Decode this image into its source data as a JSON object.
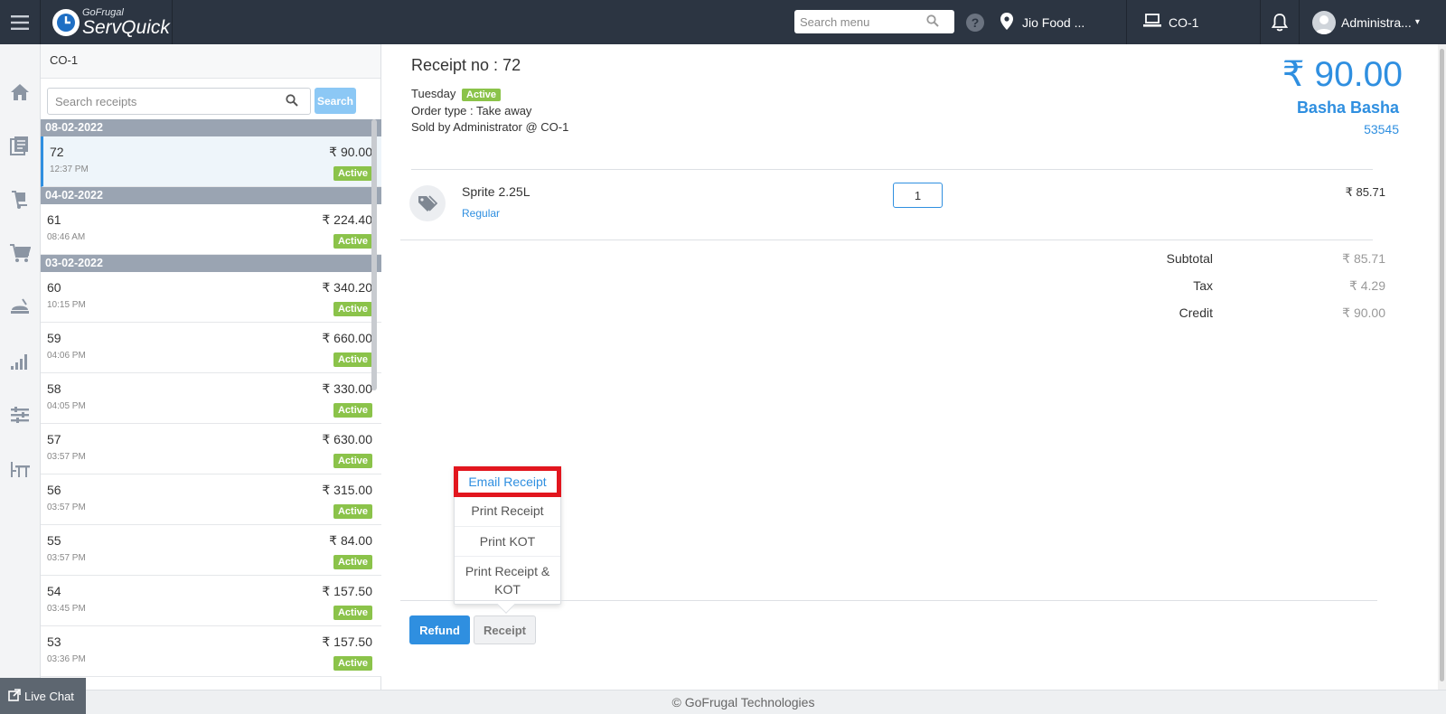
{
  "header": {
    "logo_small": "GoFrugal",
    "logo_big": "ServQuick",
    "search_placeholder": "Search menu",
    "location": "Jio Food ...",
    "counter": "CO-1",
    "user": "Administra..."
  },
  "sidebar": {
    "counter_label": "CO-1",
    "search_placeholder": "Search receipts",
    "search_button": "Search",
    "groups": [
      {
        "date": "08-02-2022",
        "rows": [
          {
            "num": "72",
            "time": "12:37 PM",
            "amount": "₹ 90.00",
            "status": "Active"
          }
        ]
      },
      {
        "date": "04-02-2022",
        "rows": [
          {
            "num": "61",
            "time": "08:46 AM",
            "amount": "₹ 224.40",
            "status": "Active"
          }
        ]
      },
      {
        "date": "03-02-2022",
        "rows": [
          {
            "num": "60",
            "time": "10:15 PM",
            "amount": "₹ 340.20",
            "status": "Active"
          },
          {
            "num": "59",
            "time": "04:06 PM",
            "amount": "₹ 660.00",
            "status": "Active"
          },
          {
            "num": "58",
            "time": "04:05 PM",
            "amount": "₹ 330.00",
            "status": "Active"
          },
          {
            "num": "57",
            "time": "03:57 PM",
            "amount": "₹ 630.00",
            "status": "Active"
          },
          {
            "num": "56",
            "time": "03:57 PM",
            "amount": "₹ 315.00",
            "status": "Active"
          },
          {
            "num": "55",
            "time": "03:57 PM",
            "amount": "₹ 84.00",
            "status": "Active"
          },
          {
            "num": "54",
            "time": "03:45 PM",
            "amount": "₹ 157.50",
            "status": "Active"
          },
          {
            "num": "53",
            "time": "03:36 PM",
            "amount": "₹ 157.50",
            "status": "Active"
          }
        ]
      }
    ]
  },
  "receipt": {
    "title": "Receipt no : 72",
    "day": "Tuesday",
    "status": "Active",
    "order_type": "Order type : Take away",
    "sold_by": "Sold by Administrator @ CO-1",
    "total": "₹ 90.00",
    "customer_name": "Basha Basha",
    "customer_id": "53545",
    "item": {
      "name": "Sprite 2.25L",
      "variant": "Regular",
      "qty": "1",
      "price": "₹ 85.71"
    },
    "summary": [
      {
        "label": "Subtotal",
        "value": "₹ 85.71"
      },
      {
        "label": "Tax",
        "value": "₹ 4.29"
      },
      {
        "label": "Credit",
        "value": "₹ 90.00"
      }
    ]
  },
  "receipt_menu": {
    "email": "Email Receipt",
    "print_receipt": "Print Receipt",
    "print_kot": "Print KOT",
    "print_both": "Print Receipt & KOT"
  },
  "actions": {
    "refund": "Refund",
    "receipt": "Receipt"
  },
  "footer": {
    "copyright": "© GoFrugal Technologies",
    "live_chat": "Live Chat"
  },
  "colors": {
    "topbar": "#2c3542",
    "accent": "#2f8fe0",
    "active": "#8bc34a",
    "highlight": "#e2161e"
  }
}
